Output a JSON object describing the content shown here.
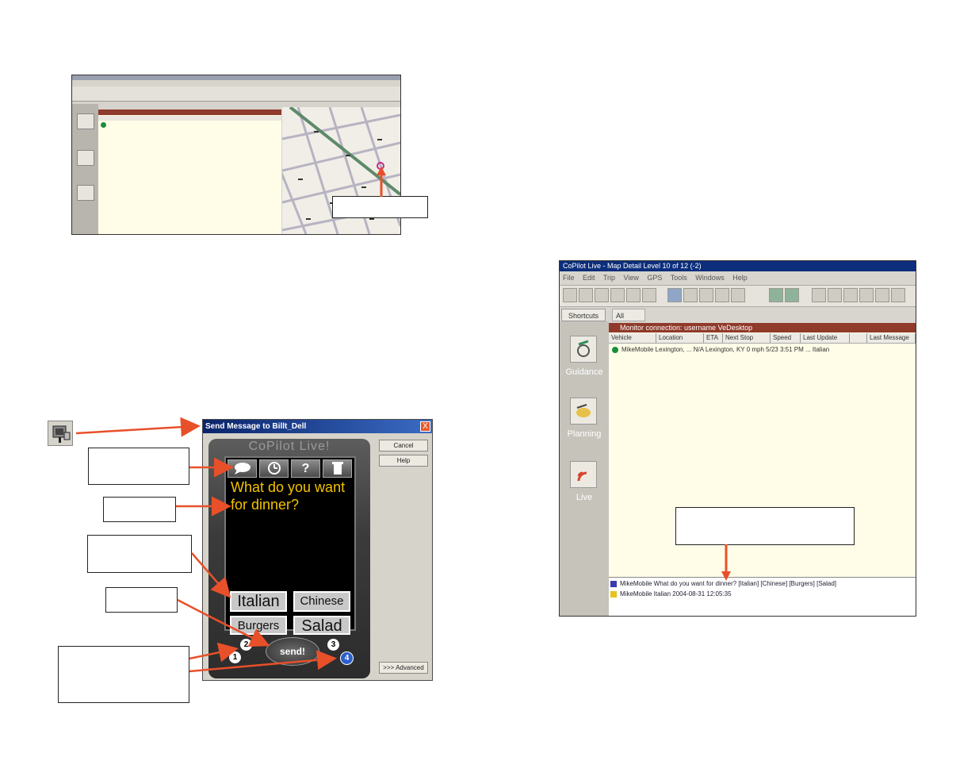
{
  "dialog": {
    "title": "Send Message to Billt_Dell",
    "close_glyph": "X",
    "cancel_label": "Cancel",
    "help_label": "Help",
    "advanced_label": ">>> Advanced",
    "device_brand": "CoPilot Live!",
    "question": "What do you want for dinner?",
    "options": [
      "Italian",
      "Chinese",
      "Burgers",
      "Salad"
    ],
    "send_label": "send!",
    "help_glyph": "?",
    "numbers": [
      "1",
      "2",
      "3",
      "4"
    ]
  },
  "live_window": {
    "title": "CoPilot Live - Map Detail Level 10 of 12 (-2)",
    "menu": "File  Edit  Trip  View  GPS  Tools  Windows  Help",
    "tab_shortcuts": "Shortcuts",
    "tab_all": "All",
    "group_header": "Monitor connection: username VeDesktop",
    "columns": [
      "Vehicle",
      "Location",
      "ETA",
      "Next Stop",
      "Speed",
      "Last Update",
      "",
      "Last Message"
    ],
    "row": "MikeMobile   Lexington, ...   N/A   Lexington, KY   0 mph   5/23 3:51 PM   ...   Italian",
    "shortcuts": [
      "Guidance",
      "Planning",
      "Live"
    ],
    "messages": [
      "MikeMobile   What do you want for dinner? [Italian] [Chinese] [Burgers] [Salad]",
      "MikeMobile   Italian          2004-08-31 12:05:35"
    ]
  },
  "colors": {
    "arrow": "#e8502a",
    "question_text": "#f3c300",
    "list_header": "#8f3a2b",
    "list_background": "#fffde8"
  }
}
